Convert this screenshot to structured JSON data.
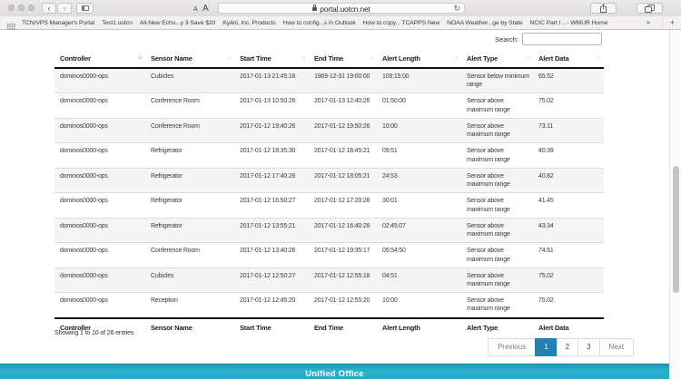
{
  "browser": {
    "url": "portal.uotcn.net",
    "reader_small": "A",
    "reader_large": "A",
    "bookmarks": [
      "TCN/VPS Manager's Portal",
      "Test1 uotcn",
      "All-New Echo...y 3 Save $20",
      "Kyäni, Inc. Products",
      "How to config...s in Outlook",
      "How to copy... TCAPPS New",
      "NOAA Weather...ge by State",
      "NCIC Part I ...- WMUR Home"
    ],
    "bookmarks_overflow": "»",
    "new_tab": "+"
  },
  "search": {
    "label": "Search:",
    "value": ""
  },
  "table": {
    "columns": [
      "Controller",
      "Sensor Name",
      "Start Time",
      "End Time",
      "Alert Length",
      "Alert Type",
      "Alert Data"
    ],
    "sorted_column": "Controller",
    "sort_icon": "↓↑",
    "rows": [
      [
        "dominos0000-ops",
        "Cubicles",
        "2017-01-13 21:45:18",
        "1969-12-31 19:00:00",
        "109:15:00",
        "Sensor below minimum range",
        "65.52"
      ],
      [
        "dominos0000-ops",
        "Conference Room",
        "2017-01-13 10:50:26",
        "2017-01-13 12:40:26",
        "01:50:00",
        "Sensor above maximum range",
        "75.02"
      ],
      [
        "dominos0000-ops",
        "Conference Room",
        "2017-01-12 19:40:26",
        "2017-01-12 19:50:26",
        "10:00",
        "Sensor above maximum range",
        "73.11"
      ],
      [
        "dominos0000-ops",
        "Refrigerator",
        "2017-01-12 18:35:30",
        "2017-01-12 18:45:21",
        "09:51",
        "Sensor above maximum range",
        "40.39"
      ],
      [
        "dominos0000-ops",
        "Refrigerator",
        "2017-01-12 17:40:28",
        "2017-01-12 18:05:21",
        "24:53",
        "Sensor above maximum range",
        "40.82"
      ],
      [
        "dominos0000-ops",
        "Refrigerator",
        "2017-01-12 16:50:27",
        "2017-01-12 17:20:28",
        "30:01",
        "Sensor above maximum range",
        "41.45"
      ],
      [
        "dominos0000-ops",
        "Refrigerator",
        "2017-01-12 13:55:21",
        "2017-01-12 16:40:28",
        "02:45:07",
        "Sensor above maximum range",
        "43.34"
      ],
      [
        "dominos0000-ops",
        "Conference Room",
        "2017-01-12 13:40:26",
        "2017-01-12 19:35:17",
        "05:54:50",
        "Sensor above maximum range",
        "74.61"
      ],
      [
        "dominos0000-ops",
        "Cubicles",
        "2017-01-12 12:50:27",
        "2017-01-12 12:55:18",
        "04:51",
        "Sensor above maximum range",
        "75.02"
      ],
      [
        "dominos0000-ops",
        "Reception",
        "2017-01-12 12:45:20",
        "2017-01-12 12:55:20",
        "10:00",
        "Sensor above maximum range",
        "75.02"
      ]
    ]
  },
  "info": "Showing 1 to 10 of 26 entries",
  "pagination": {
    "previous": "Previous",
    "pages": [
      "1",
      "2",
      "3"
    ],
    "active_page": "1",
    "next": "Next"
  },
  "footer": {
    "brand": "Unified Office"
  },
  "colors": {
    "accent_blue": "#2181b4",
    "brand_teal": "#26aac8"
  }
}
